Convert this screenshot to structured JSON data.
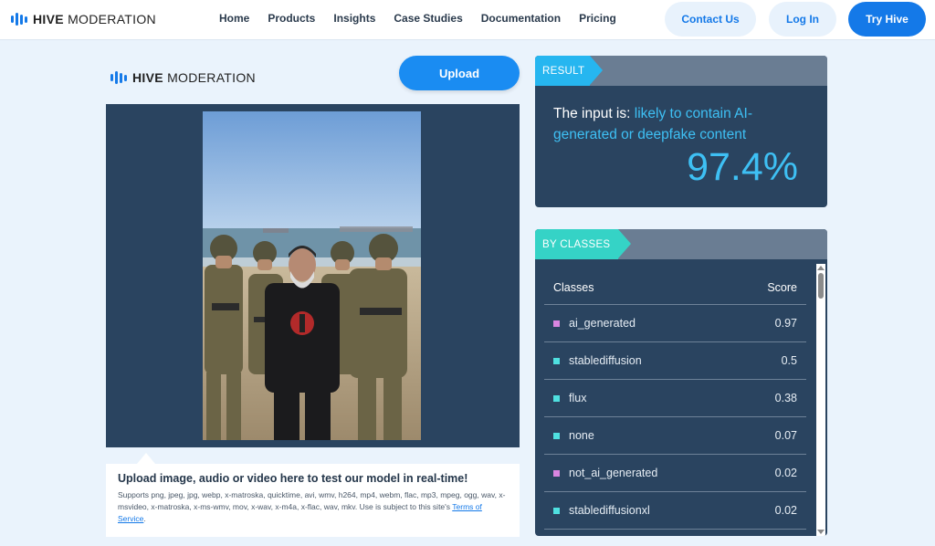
{
  "nav": {
    "logo_bold": "HIVE",
    "logo_rest": "MODERATION",
    "links": [
      "Home",
      "Products",
      "Insights",
      "Case Studies",
      "Documentation",
      "Pricing"
    ],
    "contact": "Contact Us",
    "login": "Log In",
    "try": "Try Hive"
  },
  "panel": {
    "logo_bold": "HIVE",
    "logo_rest": "MODERATION",
    "upload_label": "Upload",
    "caption_title": "Upload image, audio or video here to test our model in real-time!",
    "caption_text": "Supports png, jpeg, jpg, webp, x-matroska, quicktime, avi, wmv, h264, mp4, webm, flac, mp3, mpeg, ogg, wav, x-msvideo, x-matroska, x-ms-wmv, mov, x-wav, x-m4a, x-flac, wav, mkv. Use is subject to this site's",
    "terms_link": "Terms of Service",
    "terms_end": "."
  },
  "result": {
    "tag": "RESULT",
    "prefix": "The input is:",
    "verdict": "likely to contain AI-generated or deepfake content",
    "percent": "97.4%"
  },
  "classes": {
    "tag": "BY CLASSES",
    "col_class": "Classes",
    "col_score": "Score",
    "rows": [
      {
        "name": "ai_generated",
        "score": "0.97",
        "color": "#d985e0"
      },
      {
        "name": "stablediffusion",
        "score": "0.5",
        "color": "#4fe0e0"
      },
      {
        "name": "flux",
        "score": "0.38",
        "color": "#4fe0e0"
      },
      {
        "name": "none",
        "score": "0.07",
        "color": "#4fe0e0"
      },
      {
        "name": "not_ai_generated",
        "score": "0.02",
        "color": "#d985e0"
      },
      {
        "name": "stablediffusionxl",
        "score": "0.02",
        "color": "#4fe0e0"
      }
    ]
  },
  "colors": {
    "brand": "#1479e8",
    "panel": "#2a4460",
    "accent_text": "#3ec0f4"
  }
}
